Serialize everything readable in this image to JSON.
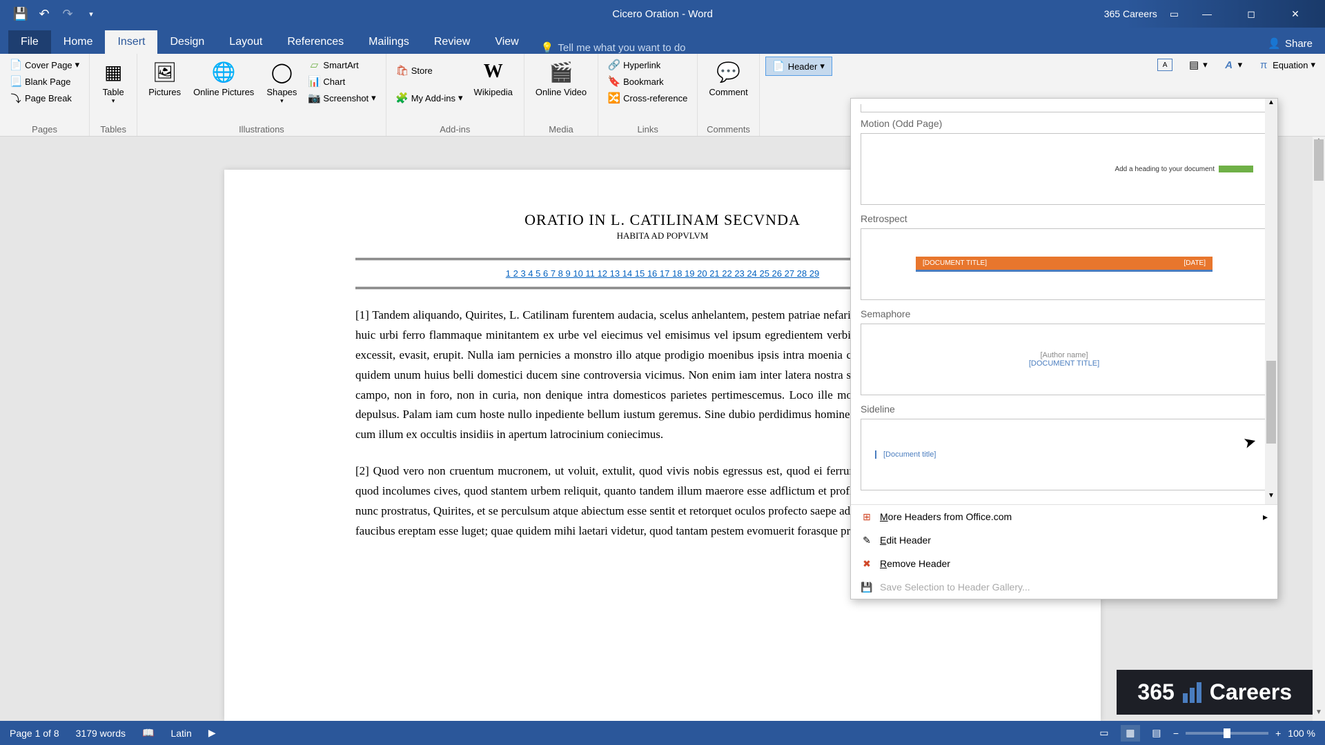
{
  "title_bar": {
    "document_title": "Cicero Oration - Word",
    "product": "365 Careers"
  },
  "menu": {
    "tabs": [
      "File",
      "Home",
      "Insert",
      "Design",
      "Layout",
      "References",
      "Mailings",
      "Review",
      "View"
    ],
    "active": "Insert",
    "tell_me": "Tell me what you want to do",
    "share": "Share"
  },
  "ribbon": {
    "pages": {
      "cover": "Cover Page",
      "blank": "Blank Page",
      "break": "Page Break",
      "label": "Pages"
    },
    "tables": {
      "table": "Table",
      "label": "Tables"
    },
    "illustrations": {
      "pictures": "Pictures",
      "online_pics": "Online Pictures",
      "shapes": "Shapes",
      "smartart": "SmartArt",
      "chart": "Chart",
      "screenshot": "Screenshot",
      "label": "Illustrations"
    },
    "addins": {
      "store": "Store",
      "myaddins": "My Add-ins",
      "wikipedia": "Wikipedia",
      "label": "Add-ins"
    },
    "media": {
      "video": "Online Video",
      "label": "Media"
    },
    "links": {
      "hyperlink": "Hyperlink",
      "bookmark": "Bookmark",
      "crossref": "Cross-reference",
      "label": "Links"
    },
    "comments": {
      "comment": "Comment",
      "label": "Comments"
    },
    "header_footer": {
      "header": "Header"
    },
    "symbols": {
      "equation": "Equation"
    }
  },
  "document": {
    "title": "ORATIO IN L. CATILINAM SECVNDA",
    "subtitle": "HABITA AD POPVLVM",
    "toc": "1 2 3 4 5 6 7 8 9 10 11 12 13 14 15 16 17 18 19 20 21 22 23 24 25 26 27 28 29",
    "para1": "[1] Tandem aliquando, Quirites, L. Catilinam furentem audacia, scelus anhelantem, pestem patriae nefarie molientem, vobis atque huic urbi ferro flammaque minitantem ex urbe vel eiecimus vel emisimus vel ipsum egredientem verbis prosecuti sumus. Abiit, excessit, evasit, erupit. Nulla iam pernicies a monstro illo atque prodigio moenibus ipsis intra moenia comparabitur. Atque hunc quidem unum huius belli domestici ducem sine controversia vicimus. Non enim iam inter latera nostra sica illa versabitur, non in campo, non in foro, non in curia, non denique intra domesticos parietes pertimescemus. Loco ille motus est, cum est ex urbe depulsus. Palam iam cum hoste nullo inpediente bellum iustum geremus. Sine dubio perdidimus hominem magnificeque vicimus, cum illum ex occultis insidiis in apertum latrocinium coniecimus.",
    "para2": "[2] Quod vero non cruentum mucronem, ut voluit, extulit, quod vivis nobis egressus est, quod ei ferrum e manibus extorsimus, quod incolumes cives, quod stantem urbem reliquit, quanto tandem illum maerore esse adflictum et profligatum putatis? Iacet ille nunc prostratus, Quirites, et se perculsum atque abiectum esse sentit et retorquet oculos profecto saepe ad hanc urbem, quam e suis faucibus ereptam esse luget; quae quidem mihi laetari videtur, quod tantam pestem evomuerit forasque proiecerit."
  },
  "dropdown": {
    "sections": {
      "motion": "Motion (Odd Page)",
      "motion_text": "Add a heading to your document",
      "retrospect": "Retrospect",
      "retro_title": "[DOCUMENT TITLE]",
      "retro_date": "[DATE]",
      "semaphore": "Semaphore",
      "sema_author": "[Author name]",
      "sema_title": "[DOCUMENT TITLE]",
      "sideline": "Sideline",
      "side_title": "[Document title]"
    },
    "menu": {
      "more": "More Headers from Office.com",
      "edit": "Edit Header",
      "remove": "Remove Header",
      "save": "Save Selection to Header Gallery..."
    }
  },
  "status": {
    "page": "Page 1 of 8",
    "words": "3179 words",
    "lang": "Latin",
    "zoom": "100 %"
  },
  "brand": "365",
  "brand2": "Careers"
}
